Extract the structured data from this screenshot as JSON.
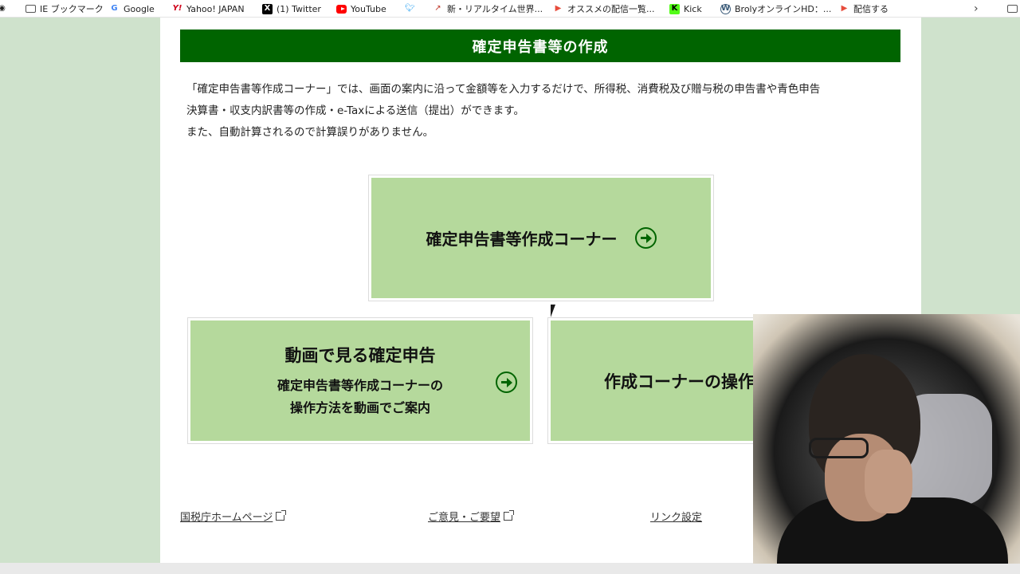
{
  "bookmarks": [
    {
      "icon": "folder-icon",
      "label": "IE ブックマーク"
    },
    {
      "icon": "google-icon",
      "label": "Google"
    },
    {
      "icon": "yahoo-icon",
      "label": "Yahoo! JAPAN"
    },
    {
      "icon": "x-icon",
      "label": "(1) Twitter"
    },
    {
      "icon": "youtube-icon",
      "label": "YouTube"
    },
    {
      "icon": "twitter-bird-icon",
      "label": ""
    },
    {
      "icon": "chart-icon",
      "label": "新・リアルタイム世界..."
    },
    {
      "icon": "stream-play-icon",
      "label": "オススメの配信一覧..."
    },
    {
      "icon": "kick-icon",
      "label": "Kick"
    },
    {
      "icon": "wordpress-icon",
      "label": "BrolyオンラインHD：..."
    },
    {
      "icon": "stream-play-icon",
      "label": "配信する"
    }
  ],
  "header": {
    "title": "確定申告書等の作成"
  },
  "intro": {
    "line1": "「確定申告書等作成コーナー」では、画面の案内に沿って金額等を入力するだけで、所得税、消費税及び贈与税の申告書や青色申告",
    "line2": "決算書・収支内訳書等の作成・e-Taxによる送信（提出）ができます。",
    "line3": "また、自動計算されるので計算誤りがありません。"
  },
  "cards": {
    "main": {
      "label": "確定申告書等作成コーナー"
    },
    "video": {
      "title": "動画で見る確定申告",
      "sub1": "確定申告書等作成コーナーの",
      "sub2": "操作方法を動画でご案内"
    },
    "guide": {
      "label": "作成コーナーの操作"
    }
  },
  "footer": {
    "nta_home": "国税庁ホームページ",
    "feedback": "ご意見・ご要望",
    "link_settings": "リンク設定"
  },
  "colors": {
    "header_green": "#006400",
    "card_green": "#b5d99c",
    "side_bg": "#cfe2cc"
  }
}
